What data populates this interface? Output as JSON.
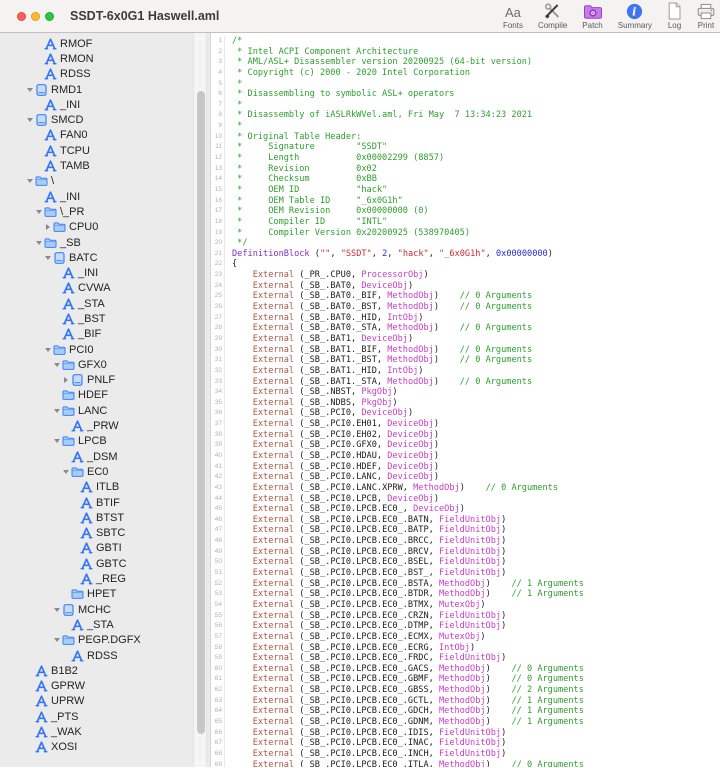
{
  "window": {
    "title": "SSDT-6x0G1 Haswell.aml"
  },
  "colors": {
    "accent_blue": "#3477f6",
    "comment_green": "#2da02d",
    "external_brown": "#a85744",
    "type_magenta": "#c83cc8",
    "string_red": "#d0282e",
    "number_blue": "#2a2ad0",
    "keyword_purple": "#7a2fc9",
    "sidebar_bg": "#ebebeb",
    "patch_purple": "#c77ae8",
    "summary_blue": "#3f74f3"
  },
  "toolbar": {
    "items": [
      {
        "name": "fonts",
        "label": "Fonts",
        "icon": "fonts-icon"
      },
      {
        "name": "compile",
        "label": "Compile",
        "icon": "compile-tools-icon"
      },
      {
        "name": "patch",
        "label": "Patch",
        "icon": "patch-folder-icon"
      },
      {
        "name": "summary",
        "label": "Summary",
        "icon": "summary-info-icon"
      },
      {
        "name": "log",
        "label": "Log",
        "icon": "log-document-icon"
      },
      {
        "name": "print",
        "label": "Print",
        "icon": "print-icon"
      }
    ]
  },
  "sidebar": {
    "items": [
      {
        "label": "RMOF",
        "icon": "method",
        "chevron": "none",
        "level": 1
      },
      {
        "label": "RMON",
        "icon": "method",
        "chevron": "none",
        "level": 1
      },
      {
        "label": "RDSS",
        "icon": "method",
        "chevron": "none",
        "level": 1
      },
      {
        "label": "RMD1",
        "icon": "device",
        "chevron": "open",
        "level": 0
      },
      {
        "label": "_INI",
        "icon": "method",
        "chevron": "none",
        "level": 1
      },
      {
        "label": "SMCD",
        "icon": "device",
        "chevron": "open",
        "level": 0
      },
      {
        "label": "FAN0",
        "icon": "method",
        "chevron": "none",
        "level": 1
      },
      {
        "label": "TCPU",
        "icon": "method",
        "chevron": "none",
        "level": 1
      },
      {
        "label": "TAMB",
        "icon": "method",
        "chevron": "none",
        "level": 1
      },
      {
        "label": "\\",
        "icon": "scope",
        "chevron": "open",
        "level": 0
      },
      {
        "label": "_INI",
        "icon": "method",
        "chevron": "none",
        "level": 1
      },
      {
        "label": "\\_PR",
        "icon": "scope",
        "chevron": "open",
        "level": 1
      },
      {
        "label": "CPU0",
        "icon": "scope",
        "chevron": "closed",
        "level": 2
      },
      {
        "label": "_SB",
        "icon": "scope",
        "chevron": "open",
        "level": 1
      },
      {
        "label": "BATC",
        "icon": "device",
        "chevron": "open",
        "level": 2
      },
      {
        "label": "_INI",
        "icon": "method",
        "chevron": "none",
        "level": 3
      },
      {
        "label": "CVWA",
        "icon": "method",
        "chevron": "none",
        "level": 3
      },
      {
        "label": "_STA",
        "icon": "method",
        "chevron": "none",
        "level": 3
      },
      {
        "label": "_BST",
        "icon": "method",
        "chevron": "none",
        "level": 3
      },
      {
        "label": "_BIF",
        "icon": "method",
        "chevron": "none",
        "level": 3
      },
      {
        "label": "PCI0",
        "icon": "scope",
        "chevron": "open",
        "level": 2
      },
      {
        "label": "GFX0",
        "icon": "scope",
        "chevron": "open",
        "level": 3
      },
      {
        "label": "PNLF",
        "icon": "device",
        "chevron": "closed",
        "level": 4
      },
      {
        "label": "HDEF",
        "icon": "scope",
        "chevron": "none",
        "level": 3
      },
      {
        "label": "LANC",
        "icon": "scope",
        "chevron": "open",
        "level": 3
      },
      {
        "label": "_PRW",
        "icon": "method",
        "chevron": "none",
        "level": 4
      },
      {
        "label": "LPCB",
        "icon": "scope",
        "chevron": "open",
        "level": 3
      },
      {
        "label": "_DSM",
        "icon": "method",
        "chevron": "none",
        "level": 4
      },
      {
        "label": "EC0",
        "icon": "scope",
        "chevron": "open",
        "level": 4
      },
      {
        "label": "ITLB",
        "icon": "method",
        "chevron": "none",
        "level": 5
      },
      {
        "label": "BTIF",
        "icon": "method",
        "chevron": "none",
        "level": 5
      },
      {
        "label": "BTST",
        "icon": "method",
        "chevron": "none",
        "level": 5
      },
      {
        "label": "SBTC",
        "icon": "method",
        "chevron": "none",
        "level": 5
      },
      {
        "label": "GBTI",
        "icon": "method",
        "chevron": "none",
        "level": 5
      },
      {
        "label": "GBTC",
        "icon": "method",
        "chevron": "none",
        "level": 5
      },
      {
        "label": "_REG",
        "icon": "method",
        "chevron": "none",
        "level": 5
      },
      {
        "label": "HPET",
        "icon": "scope",
        "chevron": "none",
        "level": 4
      },
      {
        "label": "MCHC",
        "icon": "device",
        "chevron": "open",
        "level": 3
      },
      {
        "label": "_STA",
        "icon": "method",
        "chevron": "none",
        "level": 4
      },
      {
        "label": "PEGP.DGFX",
        "icon": "scope",
        "chevron": "open",
        "level": 3
      },
      {
        "label": "RDSS",
        "icon": "method",
        "chevron": "none",
        "level": 4
      },
      {
        "label": "B1B2",
        "icon": "method",
        "chevron": "none",
        "level": 0
      },
      {
        "label": "GPRW",
        "icon": "method",
        "chevron": "none",
        "level": 0
      },
      {
        "label": "UPRW",
        "icon": "method",
        "chevron": "none",
        "level": 0
      },
      {
        "label": "_PTS",
        "icon": "method",
        "chevron": "none",
        "level": 0
      },
      {
        "label": "_WAK",
        "icon": "method",
        "chevron": "none",
        "level": 0
      },
      {
        "label": "XOSI",
        "icon": "method",
        "chevron": "none",
        "level": 0
      }
    ]
  },
  "code": {
    "lines": [
      {
        "ln": 1,
        "kind": "c",
        "text": "/*"
      },
      {
        "ln": 2,
        "kind": "c",
        "text": " * Intel ACPI Component Architecture"
      },
      {
        "ln": 3,
        "kind": "c",
        "text": " * AML/ASL+ Disassembler version 20200925 (64-bit version)"
      },
      {
        "ln": 4,
        "kind": "c",
        "text": " * Copyright (c) 2000 - 2020 Intel Corporation"
      },
      {
        "ln": 5,
        "kind": "c",
        "text": " * "
      },
      {
        "ln": 6,
        "kind": "c",
        "text": " * Disassembling to symbolic ASL+ operators"
      },
      {
        "ln": 7,
        "kind": "c",
        "text": " * "
      },
      {
        "ln": 8,
        "kind": "c",
        "text": " * Disassembly of iASLRkWVel.aml, Fri May  7 13:34:23 2021"
      },
      {
        "ln": 9,
        "kind": "c",
        "text": " * "
      },
      {
        "ln": 10,
        "kind": "c",
        "text": " * Original Table Header:"
      },
      {
        "ln": 11,
        "kind": "c",
        "text": " *     Signature        \"SSDT\""
      },
      {
        "ln": 12,
        "kind": "c",
        "text": " *     Length           0x00002299 (8857)"
      },
      {
        "ln": 13,
        "kind": "c",
        "text": " *     Revision         0x02"
      },
      {
        "ln": 14,
        "kind": "c",
        "text": " *     Checksum         0xBB"
      },
      {
        "ln": 15,
        "kind": "c",
        "text": " *     OEM ID           \"hack\""
      },
      {
        "ln": 16,
        "kind": "c",
        "text": " *     OEM Table ID     \"_6x0G1h\""
      },
      {
        "ln": 17,
        "kind": "c",
        "text": " *     OEM Revision     0x00000000 (0)"
      },
      {
        "ln": 18,
        "kind": "c",
        "text": " *     Compiler ID      \"INTL\""
      },
      {
        "ln": 19,
        "kind": "c",
        "text": " *     Compiler Version 0x20200925 (538970405)"
      },
      {
        "ln": 20,
        "kind": "c",
        "text": " */"
      },
      {
        "ln": 21,
        "kind": "seg",
        "segs": [
          [
            "k",
            "DefinitionBlock"
          ],
          [
            "p",
            " ("
          ],
          [
            "s",
            "\"\""
          ],
          [
            "p",
            ", "
          ],
          [
            "s",
            "\"SSDT\""
          ],
          [
            "p",
            ", "
          ],
          [
            "n",
            "2"
          ],
          [
            "p",
            ", "
          ],
          [
            "s",
            "\"hack\""
          ],
          [
            "p",
            ", "
          ],
          [
            "s",
            "\"_6x0G1h\""
          ],
          [
            "p",
            ", "
          ],
          [
            "n",
            "0x00000000"
          ],
          [
            "p",
            ")"
          ]
        ]
      },
      {
        "ln": 22,
        "kind": "p",
        "text": "{"
      },
      {
        "ln": 23,
        "kind": "x",
        "path": "_PR_.CPU0",
        "type": "ProcessorObj"
      },
      {
        "ln": 24,
        "kind": "x",
        "path": "_SB_.BAT0",
        "type": "DeviceObj"
      },
      {
        "ln": 25,
        "kind": "x",
        "path": "_SB_.BAT0._BIF",
        "type": "MethodObj",
        "args": 0
      },
      {
        "ln": 26,
        "kind": "x",
        "path": "_SB_.BAT0._BST",
        "type": "MethodObj",
        "args": 0
      },
      {
        "ln": 27,
        "kind": "x",
        "path": "_SB_.BAT0._HID",
        "type": "IntObj"
      },
      {
        "ln": 28,
        "kind": "x",
        "path": "_SB_.BAT0._STA",
        "type": "MethodObj",
        "args": 0
      },
      {
        "ln": 29,
        "kind": "x",
        "path": "_SB_.BAT1",
        "type": "DeviceObj"
      },
      {
        "ln": 30,
        "kind": "x",
        "path": "_SB_.BAT1._BIF",
        "type": "MethodObj",
        "args": 0
      },
      {
        "ln": 31,
        "kind": "x",
        "path": "_SB_.BAT1._BST",
        "type": "MethodObj",
        "args": 0
      },
      {
        "ln": 32,
        "kind": "x",
        "path": "_SB_.BAT1._HID",
        "type": "IntObj"
      },
      {
        "ln": 33,
        "kind": "x",
        "path": "_SB_.BAT1._STA",
        "type": "MethodObj",
        "args": 0
      },
      {
        "ln": 34,
        "kind": "x",
        "path": "_SB_.NBST",
        "type": "PkgObj"
      },
      {
        "ln": 35,
        "kind": "x",
        "path": "_SB_.NDBS",
        "type": "PkgObj"
      },
      {
        "ln": 36,
        "kind": "x",
        "path": "_SB_.PCI0",
        "type": "DeviceObj"
      },
      {
        "ln": 37,
        "kind": "x",
        "path": "_SB_.PCI0.EH01",
        "type": "DeviceObj"
      },
      {
        "ln": 38,
        "kind": "x",
        "path": "_SB_.PCI0.EH02",
        "type": "DeviceObj"
      },
      {
        "ln": 39,
        "kind": "x",
        "path": "_SB_.PCI0.GFX0",
        "type": "DeviceObj"
      },
      {
        "ln": 40,
        "kind": "x",
        "path": "_SB_.PCI0.HDAU",
        "type": "DeviceObj"
      },
      {
        "ln": 41,
        "kind": "x",
        "path": "_SB_.PCI0.HDEF",
        "type": "DeviceObj"
      },
      {
        "ln": 42,
        "kind": "x",
        "path": "_SB_.PCI0.LANC",
        "type": "DeviceObj"
      },
      {
        "ln": 43,
        "kind": "x",
        "path": "_SB_.PCI0.LANC.XPRW",
        "type": "MethodObj",
        "args": 0
      },
      {
        "ln": 44,
        "kind": "x",
        "path": "_SB_.PCI0.LPCB",
        "type": "DeviceObj"
      },
      {
        "ln": 45,
        "kind": "x",
        "path": "_SB_.PCI0.LPCB.EC0_",
        "type": "DeviceObj"
      },
      {
        "ln": 46,
        "kind": "x",
        "path": "_SB_.PCI0.LPCB.EC0_.BATN",
        "type": "FieldUnitObj"
      },
      {
        "ln": 47,
        "kind": "x",
        "path": "_SB_.PCI0.LPCB.EC0_.BATP",
        "type": "FieldUnitObj"
      },
      {
        "ln": 48,
        "kind": "x",
        "path": "_SB_.PCI0.LPCB.EC0_.BRCC",
        "type": "FieldUnitObj"
      },
      {
        "ln": 49,
        "kind": "x",
        "path": "_SB_.PCI0.LPCB.EC0_.BRCV",
        "type": "FieldUnitObj"
      },
      {
        "ln": 50,
        "kind": "x",
        "path": "_SB_.PCI0.LPCB.EC0_.BSEL",
        "type": "FieldUnitObj"
      },
      {
        "ln": 51,
        "kind": "x",
        "path": "_SB_.PCI0.LPCB.EC0_.BST_",
        "type": "FieldUnitObj"
      },
      {
        "ln": 52,
        "kind": "x",
        "path": "_SB_.PCI0.LPCB.EC0_.BSTA",
        "type": "MethodObj",
        "args": 1
      },
      {
        "ln": 53,
        "kind": "x",
        "path": "_SB_.PCI0.LPCB.EC0_.BTDR",
        "type": "MethodObj",
        "args": 1
      },
      {
        "ln": 54,
        "kind": "x",
        "path": "_SB_.PCI0.LPCB.EC0_.BTMX",
        "type": "MutexObj"
      },
      {
        "ln": 55,
        "kind": "x",
        "path": "_SB_.PCI0.LPCB.EC0_.CRZN",
        "type": "FieldUnitObj"
      },
      {
        "ln": 56,
        "kind": "x",
        "path": "_SB_.PCI0.LPCB.EC0_.DTMP",
        "type": "FieldUnitObj"
      },
      {
        "ln": 57,
        "kind": "x",
        "path": "_SB_.PCI0.LPCB.EC0_.ECMX",
        "type": "MutexObj"
      },
      {
        "ln": 58,
        "kind": "x",
        "path": "_SB_.PCI0.LPCB.EC0_.ECRG",
        "type": "IntObj"
      },
      {
        "ln": 59,
        "kind": "x",
        "path": "_SB_.PCI0.LPCB.EC0_.FRDC",
        "type": "FieldUnitObj"
      },
      {
        "ln": 60,
        "kind": "x",
        "path": "_SB_.PCI0.LPCB.EC0_.GACS",
        "type": "MethodObj",
        "args": 0
      },
      {
        "ln": 61,
        "kind": "x",
        "path": "_SB_.PCI0.LPCB.EC0_.GBMF",
        "type": "MethodObj",
        "args": 0
      },
      {
        "ln": 62,
        "kind": "x",
        "path": "_SB_.PCI0.LPCB.EC0_.GBSS",
        "type": "MethodObj",
        "args": 2
      },
      {
        "ln": 63,
        "kind": "x",
        "path": "_SB_.PCI0.LPCB.EC0_.GCTL",
        "type": "MethodObj",
        "args": 1
      },
      {
        "ln": 64,
        "kind": "x",
        "path": "_SB_.PCI0.LPCB.EC0_.GDCH",
        "type": "MethodObj",
        "args": 1
      },
      {
        "ln": 65,
        "kind": "x",
        "path": "_SB_.PCI0.LPCB.EC0_.GDNM",
        "type": "MethodObj",
        "args": 1
      },
      {
        "ln": 66,
        "kind": "x",
        "path": "_SB_.PCI0.LPCB.EC0_.IDIS",
        "type": "FieldUnitObj"
      },
      {
        "ln": 67,
        "kind": "x",
        "path": "_SB_.PCI0.LPCB.EC0_.INAC",
        "type": "FieldUnitObj"
      },
      {
        "ln": 68,
        "kind": "x",
        "path": "_SB_.PCI0.LPCB.EC0_.INCH",
        "type": "FieldUnitObj"
      },
      {
        "ln": 69,
        "kind": "x",
        "path": "_SB_.PCI0.LPCB.EC0_.ITLA",
        "type": "MethodObj",
        "args": 0
      }
    ]
  }
}
